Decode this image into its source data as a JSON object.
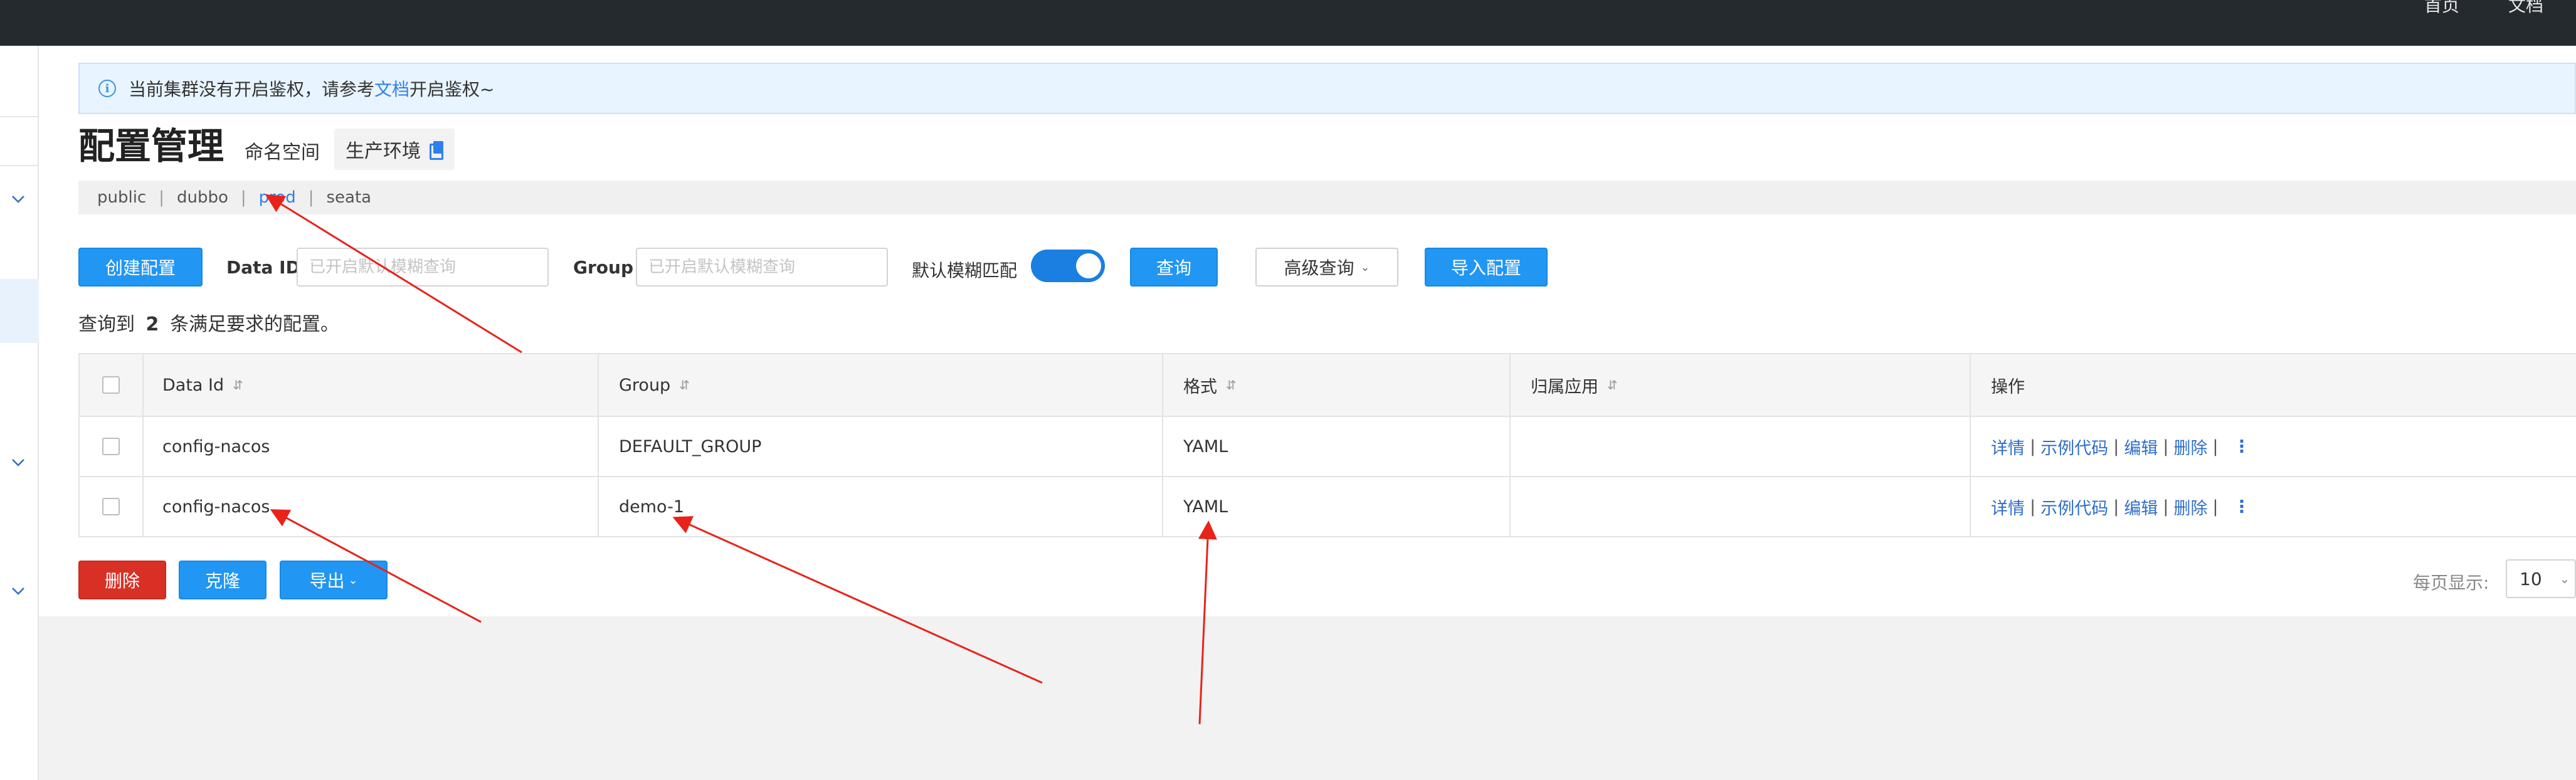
{
  "topbar": {
    "nav": [
      "首页",
      "文档"
    ]
  },
  "notice": {
    "text_before": "当前集群没有开启鉴权，请参考",
    "link": "文档",
    "text_after": "开启鉴权~"
  },
  "header": {
    "title": "配置管理",
    "namespace_label": "命名空间",
    "namespace_value": "生产环境"
  },
  "namespaces": [
    "public",
    "dubbo",
    "prod",
    "seata"
  ],
  "active_namespace": "prod",
  "toolbar": {
    "create_label": "创建配置",
    "dataid_label": "Data ID",
    "dataid_placeholder": "已开启默认模糊查询",
    "group_label": "Group",
    "group_placeholder": "已开启默认模糊查询",
    "fuzzy_label": "默认模糊匹配",
    "fuzzy_on": true,
    "query_label": "查询",
    "advanced_label": "高级查询",
    "import_label": "导入配置"
  },
  "result": {
    "prefix": "查询到",
    "count": "2",
    "suffix": "条满足要求的配置。"
  },
  "table": {
    "columns": [
      "Data Id",
      "Group",
      "格式",
      "归属应用",
      "操作"
    ],
    "rows": [
      {
        "data_id": "config-nacos",
        "group": "DEFAULT_GROUP",
        "format": "YAML",
        "app": ""
      },
      {
        "data_id": "config-nacos",
        "group": "demo-1",
        "format": "YAML",
        "app": ""
      }
    ],
    "actions": [
      "详情",
      "示例代码",
      "编辑",
      "删除"
    ],
    "action_sep": "|",
    "more": "⋮"
  },
  "bottom": {
    "delete_label": "删除",
    "clone_label": "克隆",
    "export_label": "导出"
  },
  "pager": {
    "label": "每页显示:",
    "value": "10"
  },
  "colors": {
    "topbar": "#252a2f",
    "primary": "#2196f3",
    "danger": "#d93026",
    "link": "#2f6ec9",
    "annotation_arrow": "#e8231a"
  },
  "icons": {
    "info": "info-circle-icon",
    "copy": "copy-icon",
    "sort": "sort-icon",
    "chevron": "chevron-down-icon",
    "more": "more-vertical-icon"
  }
}
